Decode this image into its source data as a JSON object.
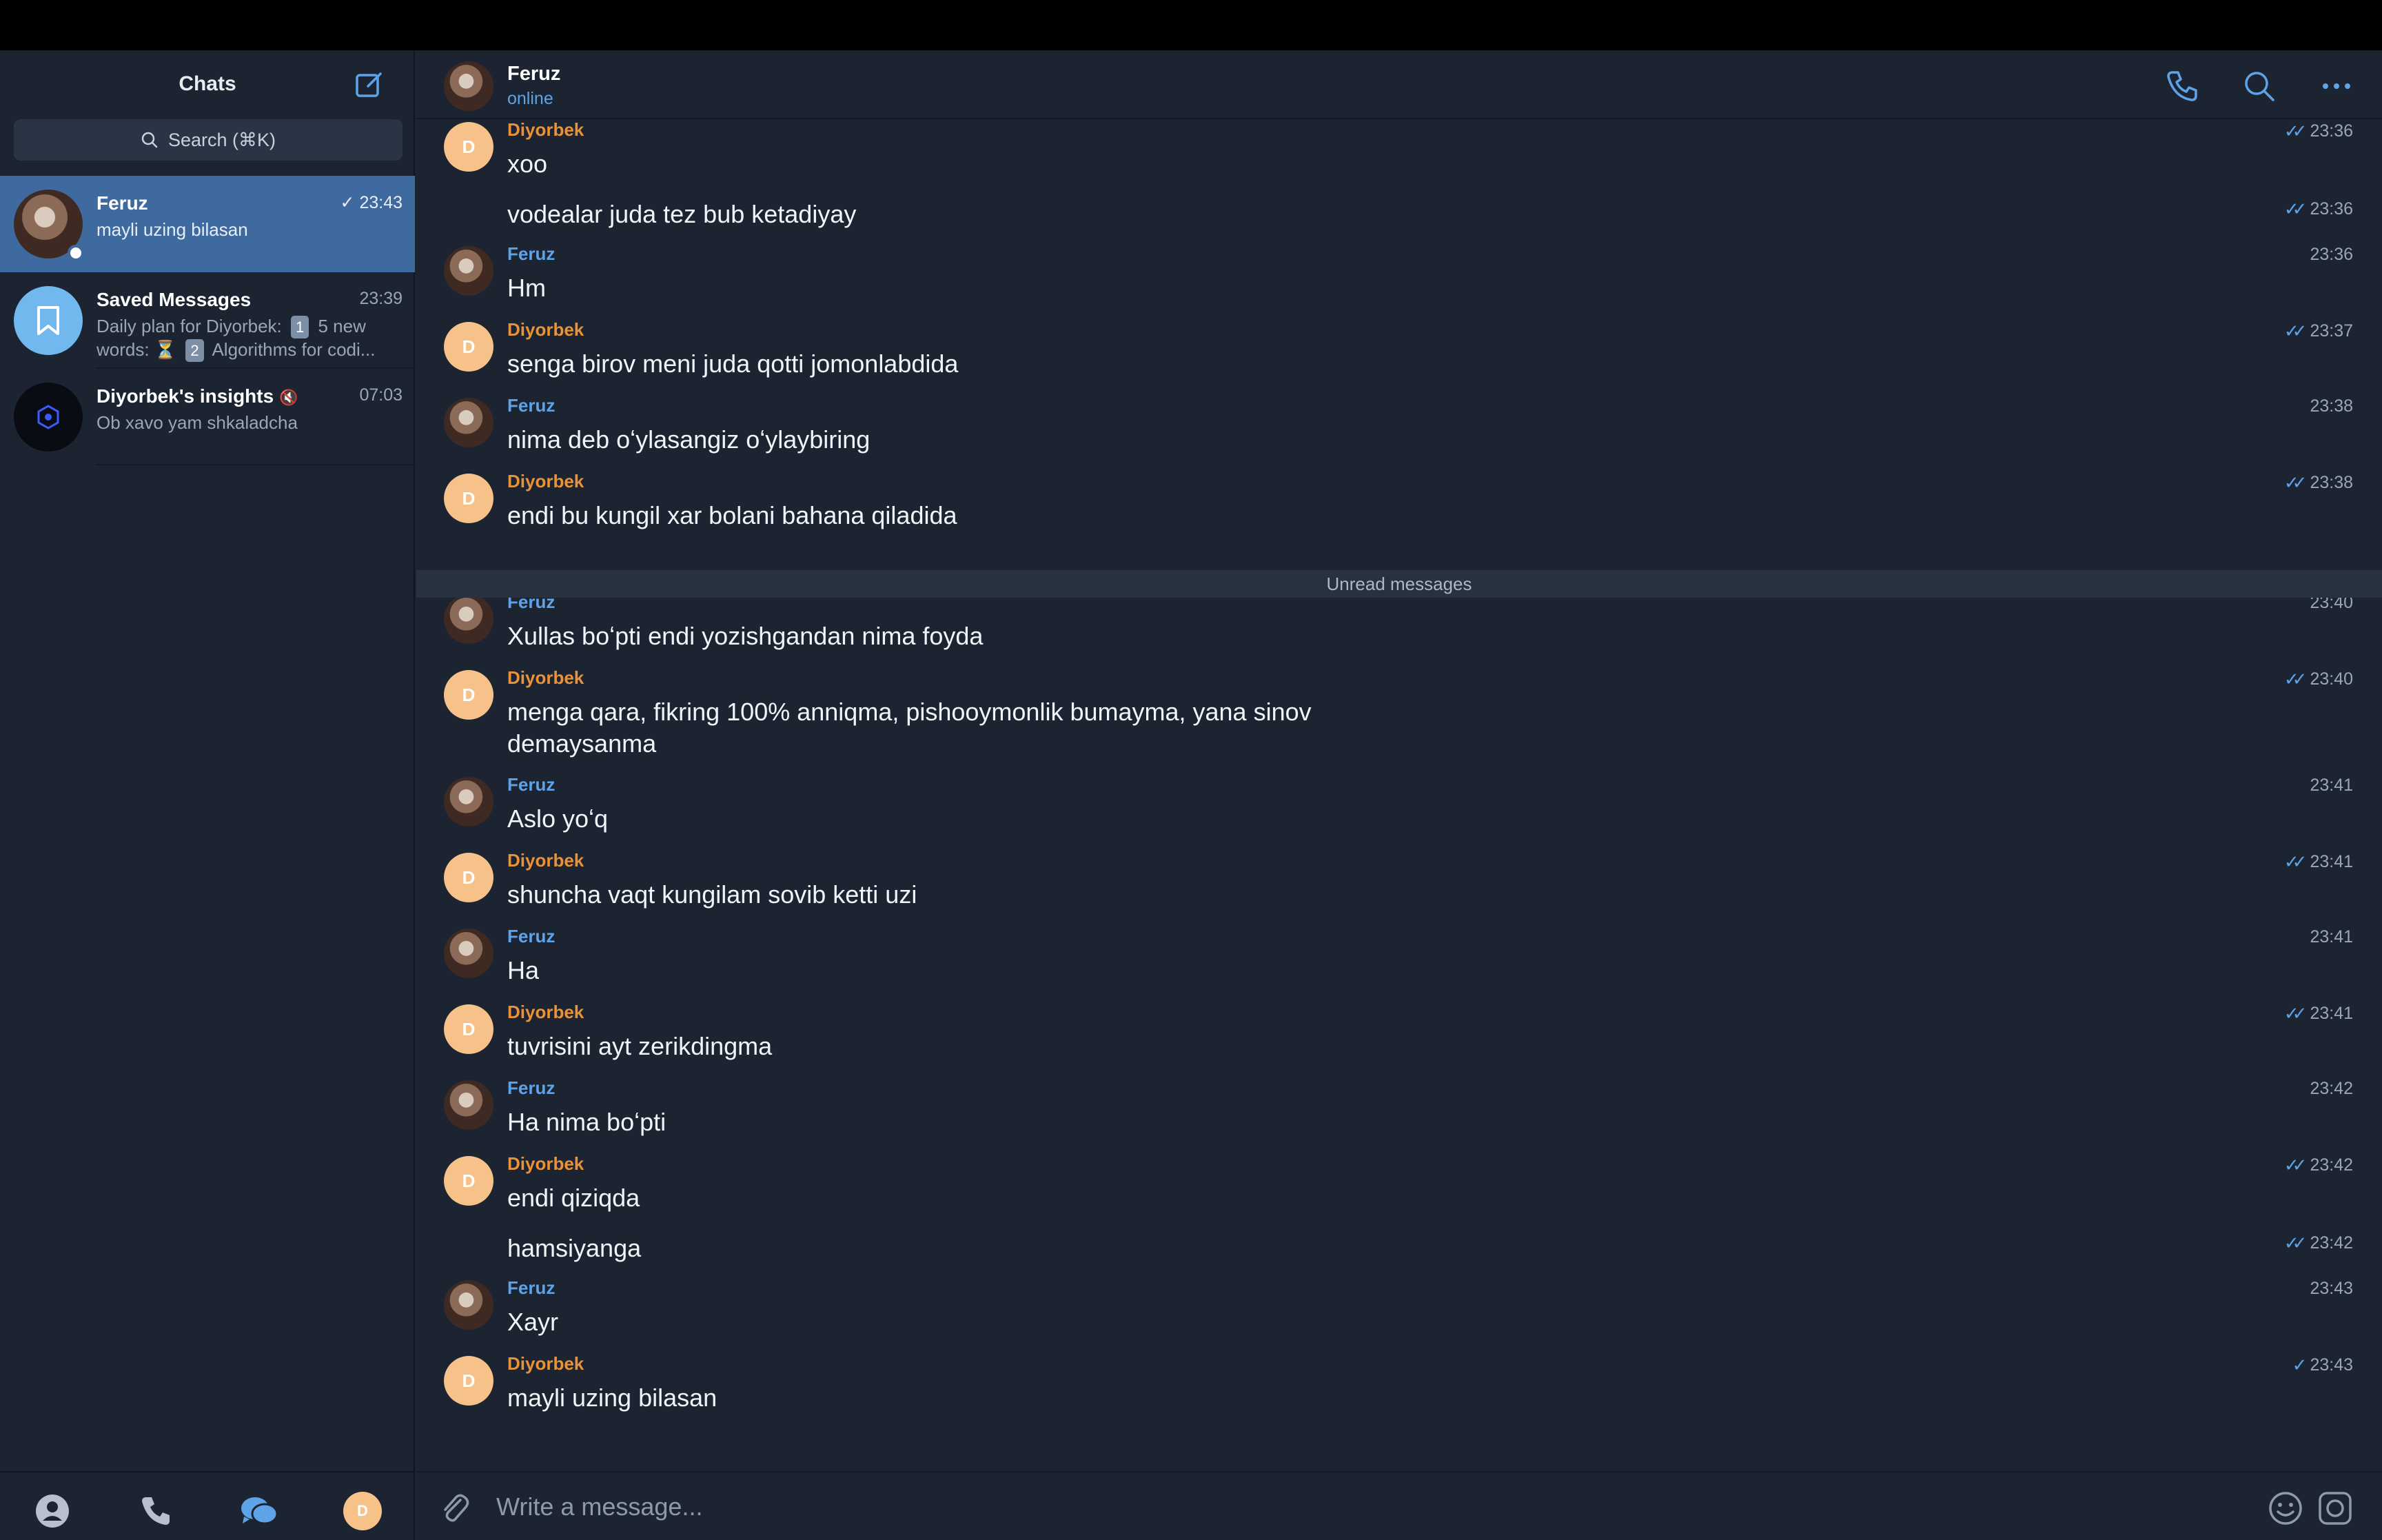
{
  "sidebar": {
    "title": "Chats",
    "search_placeholder": "Search (⌘K)",
    "chats": [
      {
        "name": "Feruz",
        "time": "23:43",
        "read_check": "✓",
        "preview": "mayli uzing bilasan",
        "online": true
      },
      {
        "name": "Saved Messages",
        "time": "23:39",
        "preview_line1": "Daily plan for Diyorbek:",
        "badge1": "1",
        "preview_tail1": "5 new",
        "preview_line2_a": "words:",
        "hourglass": "⏳",
        "badge2": "2",
        "preview_line2_b": "Algorithms for codi..."
      },
      {
        "name": "Diyorbek's insights",
        "time": "07:03",
        "preview": "Ob xavo yam shkaladcha",
        "muted": true
      }
    ],
    "bottom_nav": [
      "contacts-icon",
      "calls-icon",
      "chats-icon",
      "profile-avatar"
    ],
    "profile_initial": "D"
  },
  "header": {
    "name": "Feruz",
    "status": "online"
  },
  "colors": {
    "accent": "#5ea3e8",
    "diyorbek": "#e8923a",
    "feruz": "#5ea3e8",
    "background": "#1c2431",
    "active_chat": "#3e6a9f"
  },
  "messages": [
    {
      "sender": "Diyorbek",
      "text": "xoo",
      "time": "23:36",
      "ticks": "✓✓"
    },
    {
      "sender": "",
      "text": "vodealar juda tez bub ketadiyay",
      "time": "23:36",
      "ticks": "✓✓"
    },
    {
      "sender": "Feruz",
      "text": "Hm",
      "time": "23:36",
      "ticks": ""
    },
    {
      "sender": "Diyorbek",
      "text": "senga birov meni juda qotti jomonlabdida",
      "time": "23:37",
      "ticks": "✓✓"
    },
    {
      "sender": "Feruz",
      "text": "nima deb oʻylasangiz oʻylaybiring",
      "time": "23:38",
      "ticks": ""
    },
    {
      "sender": "Diyorbek",
      "text": "endi bu kungil xar bolani bahana qiladida",
      "time": "23:38",
      "ticks": "✓✓"
    },
    {
      "sender": "Feruz",
      "text": "Xullas boʻpti endi yozishgandan nima foyda",
      "time": "23:40",
      "ticks": ""
    },
    {
      "sender": "Diyorbek",
      "text": "menga qara, fikring 100% anniqma, pishooymonlik bumayma, yana sinov demaysanma",
      "time": "23:40",
      "ticks": "✓✓"
    },
    {
      "sender": "Feruz",
      "text": "Aslo yoʻq",
      "time": "23:41",
      "ticks": ""
    },
    {
      "sender": "Diyorbek",
      "text": "shuncha vaqt kungilam sovib ketti uzi",
      "time": "23:41",
      "ticks": "✓✓"
    },
    {
      "sender": "Feruz",
      "text": "Ha",
      "time": "23:41",
      "ticks": ""
    },
    {
      "sender": "Diyorbek",
      "text": "tuvrisini ayt zerikdingma",
      "time": "23:41",
      "ticks": "✓✓"
    },
    {
      "sender": "Feruz",
      "text": "Ha nima boʻpti",
      "time": "23:42",
      "ticks": ""
    },
    {
      "sender": "Diyorbek",
      "text": "endi qiziqda",
      "time": "23:42",
      "ticks": "✓✓"
    },
    {
      "sender": "",
      "text": "hamsiyanga",
      "time": "23:42",
      "ticks": "✓✓"
    },
    {
      "sender": "Feruz",
      "text": "Xayr",
      "time": "23:43",
      "ticks": ""
    },
    {
      "sender": "Diyorbek",
      "text": "mayli uzing bilasan",
      "time": "23:43",
      "ticks": "✓"
    }
  ],
  "unread_divider": "Unread messages",
  "avatar_initial": "D",
  "composer": {
    "placeholder": "Write a message..."
  }
}
